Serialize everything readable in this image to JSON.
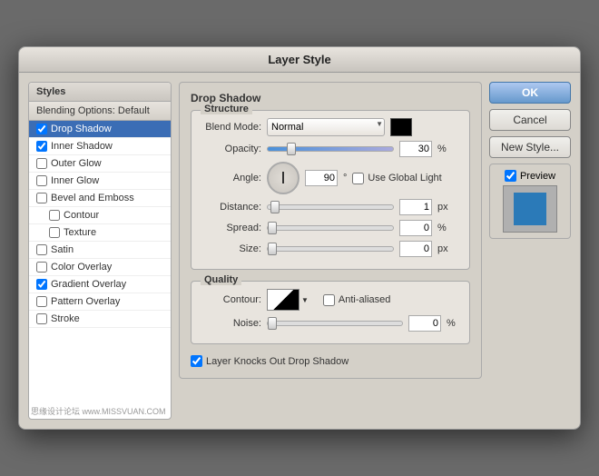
{
  "dialog": {
    "title": "Layer Style"
  },
  "sidebar": {
    "title_label": "Styles",
    "blending_label": "Blending Options: Default",
    "items": [
      {
        "id": "drop-shadow",
        "label": "Drop Shadow",
        "checked": true,
        "selected": true,
        "sub": false
      },
      {
        "id": "inner-shadow",
        "label": "Inner Shadow",
        "checked": true,
        "selected": false,
        "sub": false
      },
      {
        "id": "outer-glow",
        "label": "Outer Glow",
        "checked": false,
        "selected": false,
        "sub": false
      },
      {
        "id": "inner-glow",
        "label": "Inner Glow",
        "checked": false,
        "selected": false,
        "sub": false
      },
      {
        "id": "bevel-emboss",
        "label": "Bevel and Emboss",
        "checked": false,
        "selected": false,
        "sub": false
      },
      {
        "id": "contour",
        "label": "Contour",
        "checked": false,
        "selected": false,
        "sub": true
      },
      {
        "id": "texture",
        "label": "Texture",
        "checked": false,
        "selected": false,
        "sub": true
      },
      {
        "id": "satin",
        "label": "Satin",
        "checked": false,
        "selected": false,
        "sub": false
      },
      {
        "id": "color-overlay",
        "label": "Color Overlay",
        "checked": false,
        "selected": false,
        "sub": false
      },
      {
        "id": "gradient-overlay",
        "label": "Gradient Overlay",
        "checked": true,
        "selected": false,
        "sub": false
      },
      {
        "id": "pattern-overlay",
        "label": "Pattern Overlay",
        "checked": false,
        "selected": false,
        "sub": false
      },
      {
        "id": "stroke",
        "label": "Stroke",
        "checked": false,
        "selected": false,
        "sub": false
      }
    ]
  },
  "panel": {
    "section_title": "Drop Shadow",
    "structure_title": "Structure",
    "blend_mode_label": "Blend Mode:",
    "blend_mode_value": "Normal",
    "opacity_label": "Opacity:",
    "opacity_value": "30",
    "opacity_unit": "%",
    "angle_label": "Angle:",
    "angle_value": "90",
    "angle_degree": "°",
    "use_global_light": "Use Global Light",
    "distance_label": "Distance:",
    "distance_value": "1",
    "distance_unit": "px",
    "spread_label": "Spread:",
    "spread_value": "0",
    "spread_unit": "%",
    "size_label": "Size:",
    "size_value": "0",
    "size_unit": "px",
    "quality_title": "Quality",
    "contour_label": "Contour:",
    "anti_aliased": "Anti-aliased",
    "noise_label": "Noise:",
    "noise_value": "0",
    "noise_unit": "%",
    "layer_knocks_out": "Layer Knocks Out Drop Shadow"
  },
  "buttons": {
    "ok": "OK",
    "cancel": "Cancel",
    "new_style": "New Style...",
    "preview": "Preview"
  }
}
